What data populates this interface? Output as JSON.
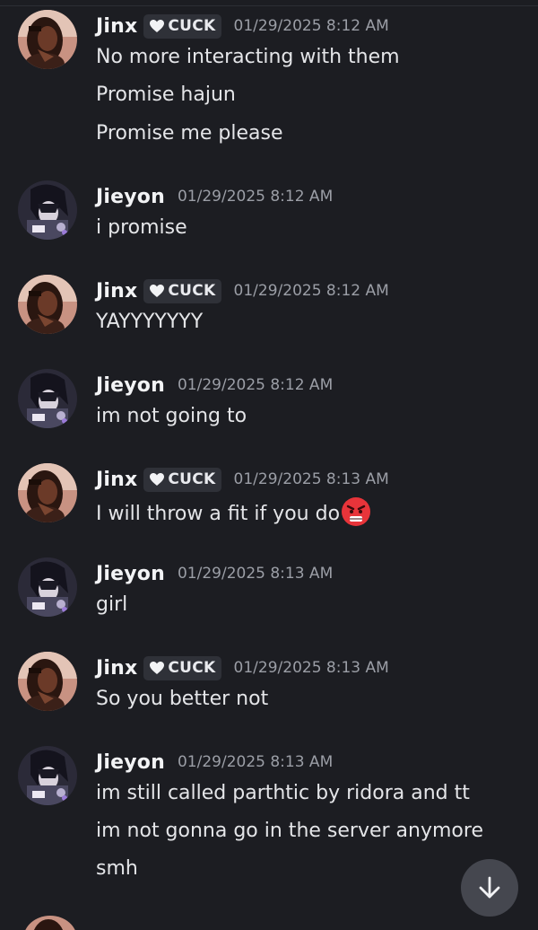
{
  "users": {
    "jinx": {
      "name": "Jinx",
      "tag": "CUCK",
      "avatar": "woman-portrait-avatar"
    },
    "jieyon": {
      "name": "Jieyon",
      "avatar": "anime-character-avatar"
    }
  },
  "messages": [
    {
      "author": "Jinx",
      "tag": "CUCK",
      "timestamp": "01/29/2025 8:12 AM",
      "lines": [
        "No more interacting with them",
        "Promise hajun",
        "Promise me please"
      ]
    },
    {
      "author": "Jieyon",
      "timestamp": "01/29/2025 8:12 AM",
      "lines": [
        "i promise"
      ]
    },
    {
      "author": "Jinx",
      "tag": "CUCK",
      "timestamp": "01/29/2025 8:12 AM",
      "lines": [
        "YAYYYYYYY"
      ]
    },
    {
      "author": "Jieyon",
      "timestamp": "01/29/2025 8:12 AM",
      "lines": [
        "im not going to"
      ]
    },
    {
      "author": "Jinx",
      "tag": "CUCK",
      "timestamp": "01/29/2025 8:13 AM",
      "lines": [
        "I will throw a fit if you do"
      ],
      "trailing_emoji": "angry-face-emoji"
    },
    {
      "author": "Jieyon",
      "timestamp": "01/29/2025 8:13 AM",
      "lines": [
        "girl"
      ]
    },
    {
      "author": "Jinx",
      "tag": "CUCK",
      "timestamp": "01/29/2025 8:13 AM",
      "lines": [
        "So you better not"
      ]
    },
    {
      "author": "Jieyon",
      "timestamp": "01/29/2025 8:13 AM",
      "lines": [
        "im still called parthtic by ridora and tt",
        "im not gonna go in the server anymore",
        "smh"
      ]
    }
  ],
  "scroll_button": {
    "icon": "arrow-down-icon"
  },
  "colors": {
    "background": "#1c1d22",
    "tag_bg": "#2f3138",
    "timestamp": "#9b9ea6",
    "emoji_red": "#e8343a"
  }
}
